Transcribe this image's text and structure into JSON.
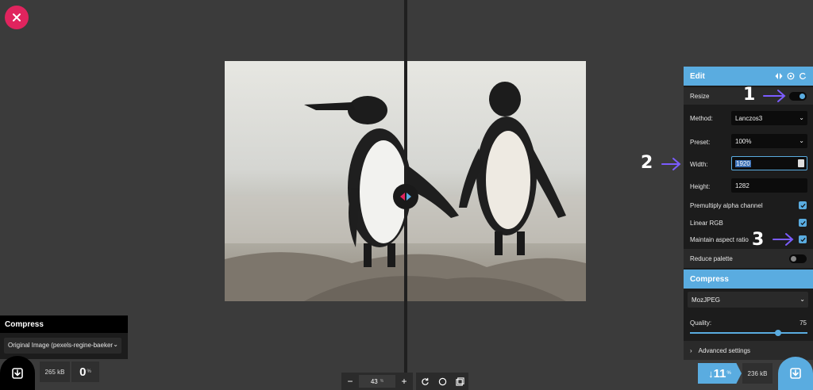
{
  "icons": {
    "close": "close-icon",
    "divider": "split-arrows-icon",
    "download": "download-icon",
    "zoom_out": "minus-icon",
    "zoom_in": "plus-icon",
    "rotate": "rotate-icon",
    "background": "circle-icon",
    "preview": "overlay-icon",
    "compare": "compare-icon",
    "expand": "expand-icon",
    "refresh": "refresh-icon"
  },
  "left_panel": {
    "title": "Compress",
    "source_select": "Original Image (pexels-regine-baeker",
    "size": "265 kB",
    "percent": "0",
    "percent_unit": "%"
  },
  "toolbar": {
    "zoom_out": "−",
    "zoom_value": "43",
    "zoom_unit": "%",
    "zoom_in": "+"
  },
  "edit_panel": {
    "title": "Edit",
    "resize_label": "Resize",
    "resize_on": true,
    "method_label": "Method:",
    "method_value": "Lanczos3",
    "preset_label": "Preset:",
    "preset_value": "100%",
    "width_label": "Width:",
    "width_value": "1920",
    "height_label": "Height:",
    "height_value": "1282",
    "premultiply_label": "Premultiply alpha channel",
    "linear_rgb_label": "Linear RGB",
    "aspect_label": "Maintain aspect ratio",
    "reduce_palette_label": "Reduce palette",
    "reduce_palette_on": false
  },
  "compress_panel": {
    "title": "Compress",
    "codec_value": "MozJPEG",
    "quality_label": "Quality:",
    "quality_value": "75",
    "quality_fraction": 0.75,
    "advanced_label": "Advanced settings"
  },
  "result": {
    "arrow": "↓",
    "percent": "11",
    "percent_unit": "%",
    "size": "236 kB"
  },
  "annotations": {
    "one": "1",
    "two": "2",
    "three": "3"
  },
  "colors": {
    "accent": "#5aace0",
    "close": "#e0245e",
    "annotation_arrow": "#7b5cff"
  }
}
